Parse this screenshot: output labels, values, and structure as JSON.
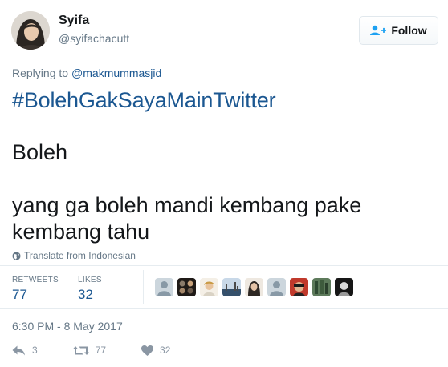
{
  "author": {
    "name": "Syifa",
    "handle": "@syifachacutt"
  },
  "follow_button": {
    "label": "Follow"
  },
  "reply_context": {
    "prefix": "Replying to",
    "mention": "@makmummasjid"
  },
  "tweet": {
    "hashtag": "#BolehGakSayaMainTwitter",
    "line1": "Boleh",
    "line2": "yang ga boleh mandi kembang pake kembang tahu"
  },
  "translate": {
    "label": "Translate from Indonesian"
  },
  "stats": {
    "retweets_label": "RETWEETS",
    "retweets_value": "77",
    "likes_label": "LIKES",
    "likes_value": "32"
  },
  "liker_avatars": [
    "default-avatar",
    "photo-avatar",
    "photo-avatar",
    "photo-avatar",
    "photo-avatar",
    "default-avatar",
    "photo-avatar",
    "photo-avatar",
    "photo-avatar"
  ],
  "timestamp": "6:30 PM - 8 May 2017",
  "actions": {
    "reply_count": "3",
    "retweet_count": "77",
    "like_count": "32"
  },
  "colors": {
    "link": "#1b5791",
    "muted": "#657786",
    "text": "#14171a",
    "divider": "#e6ecf0"
  }
}
